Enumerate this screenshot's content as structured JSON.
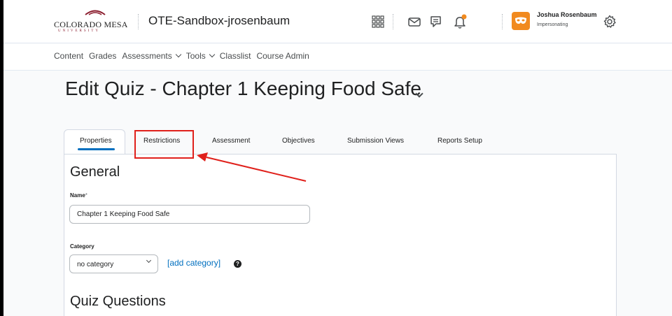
{
  "header": {
    "logo": {
      "name": "COLORADO MESA",
      "sub": "UNIVERSITY"
    },
    "org_title": "OTE-Sandbox-jrosenbaum",
    "icons": [
      "apps-grid-icon",
      "mail-icon",
      "chat-icon",
      "bell-icon"
    ],
    "user": {
      "name": "Joshua Rosenbaum",
      "status": "Impersonating"
    },
    "settings_icon": "gear-icon"
  },
  "nav": {
    "items": [
      {
        "label": "Content",
        "dropdown": false
      },
      {
        "label": "Grades",
        "dropdown": false
      },
      {
        "label": "Assessments",
        "dropdown": true
      },
      {
        "label": "Tools",
        "dropdown": true
      },
      {
        "label": "Classlist",
        "dropdown": false
      },
      {
        "label": "Course Admin",
        "dropdown": false
      }
    ]
  },
  "page": {
    "title": "Edit Quiz - Chapter 1 Keeping Food Safe"
  },
  "tabs": [
    {
      "label": "Properties",
      "active": true
    },
    {
      "label": "Restrictions",
      "active": false
    },
    {
      "label": "Assessment",
      "active": false
    },
    {
      "label": "Objectives",
      "active": false
    },
    {
      "label": "Submission Views",
      "active": false
    },
    {
      "label": "Reports Setup",
      "active": false
    }
  ],
  "form": {
    "general_heading": "General",
    "name_label": "Name",
    "name_required_mark": "*",
    "name_value": "Chapter 1 Keeping Food Safe",
    "category_label": "Category",
    "category_value": "no category",
    "add_category_link": "[add category]",
    "help_glyph": "?",
    "quiz_questions_heading": "Quiz Questions"
  },
  "colors": {
    "accent": "#006fbf",
    "avatar": "#f18a1f",
    "notification_dot": "#f18a1f",
    "annotation": "#e0201b"
  }
}
